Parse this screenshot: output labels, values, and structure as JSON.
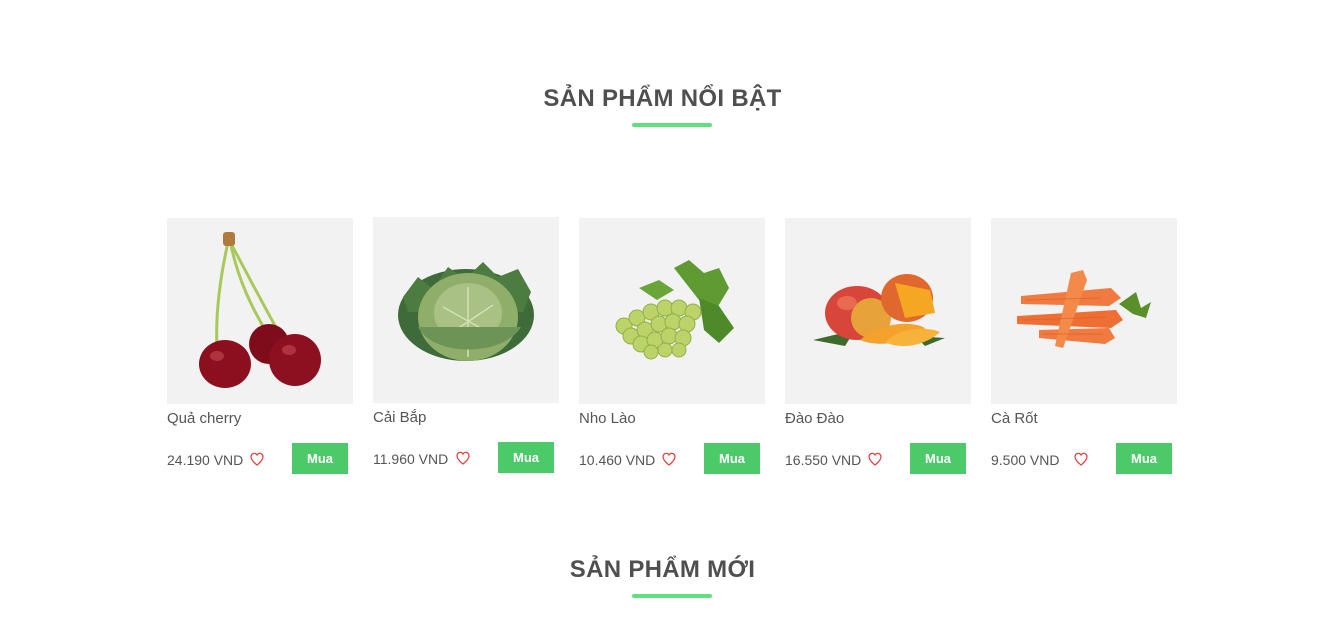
{
  "featured": {
    "title": "SẢN PHẨM NỔI BẬT",
    "products": [
      {
        "name": "Quả cherry",
        "price": "24.190 VND",
        "buy_label": "Mua",
        "icon": "cherry-image"
      },
      {
        "name": "Cải Bắp",
        "price": "11.960 VND",
        "buy_label": "Mua",
        "icon": "cabbage-image"
      },
      {
        "name": "Nho Lào",
        "price": "10.460 VND",
        "buy_label": "Mua",
        "icon": "grapes-image"
      },
      {
        "name": "Đào Đào",
        "price": "16.550 VND",
        "buy_label": "Mua",
        "icon": "mango-image"
      },
      {
        "name": "Cà Rốt",
        "price": "9.500 VND",
        "buy_label": "Mua",
        "icon": "carrot-image"
      }
    ]
  },
  "new_products": {
    "title": "SẢN PHẨM MỚI"
  },
  "colors": {
    "accent": "#5ee07f",
    "button": "#4cca6a",
    "heart": "#e53935",
    "image_bg": "#f2f2f2"
  }
}
